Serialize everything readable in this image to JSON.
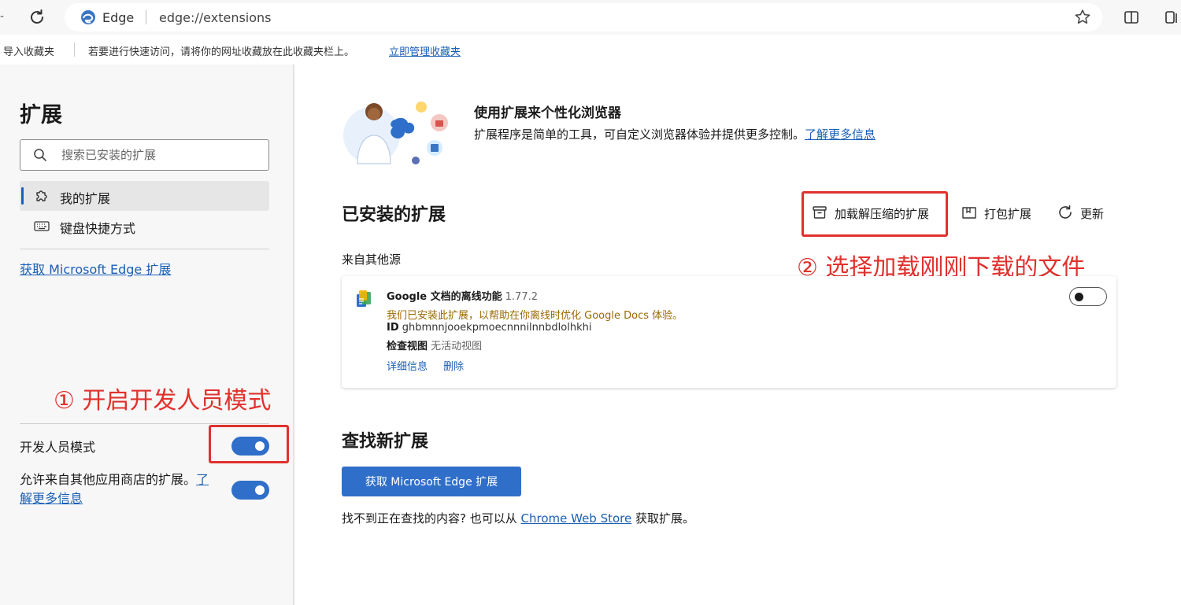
{
  "browser": {
    "back_stub": "-",
    "site_name": "Edge",
    "url": "edge://extensions"
  },
  "favorites_bar": {
    "import": "导入收藏夹",
    "hint": "若要进行快速访问，请将你的网址收藏放在此收藏夹栏上。",
    "manage_link": "立即管理收藏夹"
  },
  "sidebar": {
    "title": "扩展",
    "search_placeholder": "搜索已安装的扩展",
    "items": [
      {
        "label": "我的扩展",
        "icon": "puzzle-icon",
        "active": true
      },
      {
        "label": "键盘快捷方式",
        "icon": "keyboard-icon",
        "active": false
      }
    ],
    "get_extensions_link": "获取 Microsoft Edge 扩展",
    "developer_mode_label": "开发人员模式",
    "developer_mode_on": true,
    "allow_store_text": "允许来自其他应用商店的扩展。",
    "allow_store_link_part1": "了",
    "allow_store_link_part2": "解更多信息",
    "allow_store_on": true
  },
  "hero": {
    "title": "使用扩展来个性化浏览器",
    "description": "扩展程序是简单的工具，可自定义浏览器体验并提供更多控制。",
    "learn_more": "了解更多信息"
  },
  "installed": {
    "title": "已安装的扩展",
    "actions": [
      {
        "label": "加载解压缩的扩展",
        "icon": "archive-icon"
      },
      {
        "label": "打包扩展",
        "icon": "package-icon"
      },
      {
        "label": "更新",
        "icon": "refresh-icon"
      }
    ],
    "source_label": "来自其他源",
    "extension": {
      "name": "Google 文档的离线功能",
      "version": "1.77.2",
      "warning": "我们已安装此扩展，以帮助在你离线时优化 Google Docs 体验。",
      "id_label": "ID",
      "id_value": "ghbmnnjooekpmoecnnnilnnbdlolhkhi",
      "inspect_label": "检查视图",
      "inspect_value": "无活动视图",
      "details_link": "详细信息",
      "remove_link": "删除",
      "enabled": false
    }
  },
  "find": {
    "title": "查找新扩展",
    "button": "获取 Microsoft Edge 扩展",
    "text_before": "找不到正在查找的内容? 也可以从",
    "store_link": "Chrome Web Store",
    "text_after": "获取扩展。"
  },
  "annotations": {
    "step1": "① 开启开发人员模式",
    "step2": "② 选择加载刚刚下载的文件",
    "color": "#e0312d"
  },
  "colors": {
    "accent": "#2f6fc9",
    "link": "#1a5fb4",
    "warning": "#9a6a00"
  }
}
